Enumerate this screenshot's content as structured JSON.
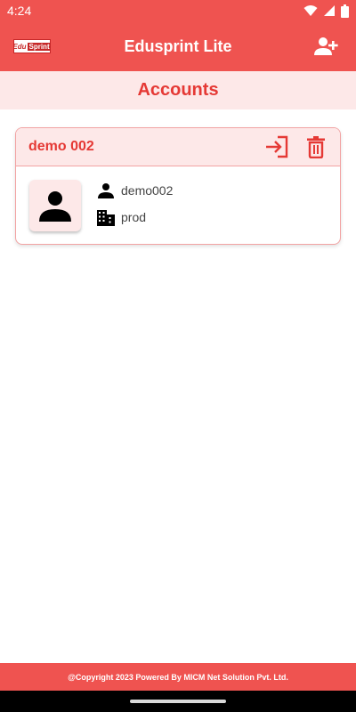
{
  "status_bar": {
    "time": "4:24",
    "icons": [
      "wifi-icon",
      "signal-icon",
      "battery-icon"
    ]
  },
  "app_bar": {
    "logo_left": "Edu",
    "logo_right": "Sprint",
    "title": "Edusprint Lite",
    "action_icon": "add-user-icon"
  },
  "section": {
    "title": "Accounts"
  },
  "accounts": [
    {
      "name": "demo 002",
      "username": "demo002",
      "organization": "prod",
      "actions": [
        "login-icon",
        "delete-icon"
      ]
    }
  ],
  "footer": {
    "text": "@Copyright 2023 Powered By MICM Net Solution Pvt. Ltd."
  },
  "colors": {
    "primary": "#ef5350",
    "accent_text": "#e53935",
    "tint": "#fde8e8",
    "border": "#f2a3a3"
  }
}
